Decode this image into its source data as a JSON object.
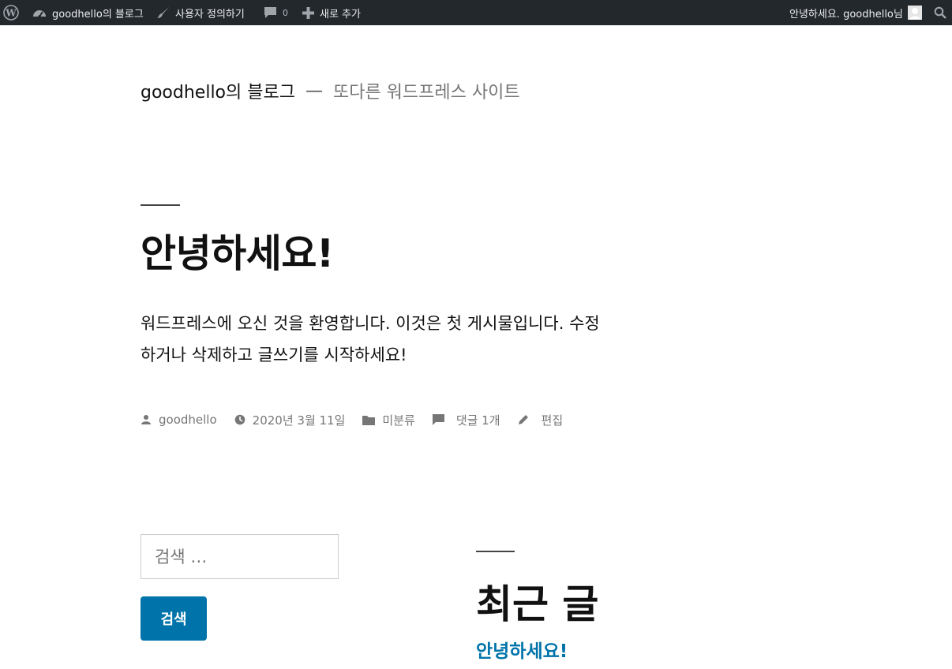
{
  "admin_bar": {
    "site_name": "goodhello의 블로그",
    "customize": "사용자 정의하기",
    "comments_count": "0",
    "new_content": "새로 추가",
    "greeting": "안녕하세요. goodhello님",
    "icons": [
      "wordpress-logo-icon",
      "dashboard-icon",
      "brush-icon",
      "comment-icon",
      "plus-icon",
      "avatar-icon",
      "search-icon"
    ]
  },
  "site": {
    "title": "goodhello의 블로그",
    "separator": "—",
    "description": "또다른 워드프레스 사이트"
  },
  "post": {
    "title": "안녕하세요!",
    "content": "워드프레스에 오신 것을 환영합니다. 이것은 첫 게시물입니다. 수정하거나 삭제하고 글쓰기를 시작하세요!",
    "meta": {
      "author": "goodhello",
      "date": "2020년 3월 11일",
      "category": "미분류",
      "comments": "댓글 1개",
      "edit": "편집"
    }
  },
  "search_widget": {
    "placeholder": "검색 …",
    "button_label": "검색"
  },
  "recent_posts": {
    "title": "최근 글",
    "items": [
      "안녕하세요!"
    ]
  },
  "colors": {
    "admin_bar_bg": "#23282d",
    "accent": "#0073aa",
    "meta_text": "#767676"
  }
}
